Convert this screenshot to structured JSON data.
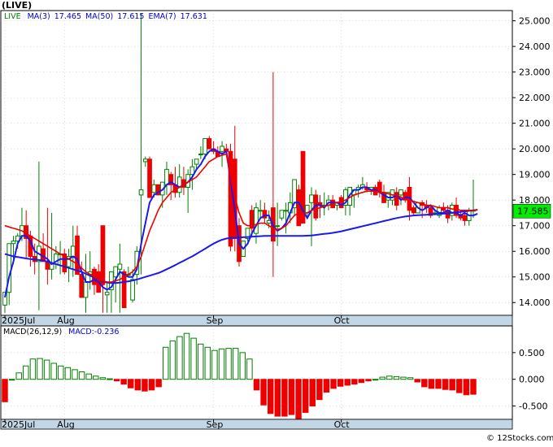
{
  "header": {
    "title": "(LIVE)",
    "legend": [
      {
        "label": "LIVE",
        "color": "#008000"
      },
      {
        "label": "MA(3)",
        "color": "#0000cc"
      },
      {
        "label": "17.465",
        "color": "#0000cc"
      },
      {
        "label": "MA(50)",
        "color": "#0000cc"
      },
      {
        "label": "17.615",
        "color": "#0000cc"
      },
      {
        "label": "EMA(7)",
        "color": "#0000cc"
      },
      {
        "label": "17.631",
        "color": "#0000cc"
      }
    ]
  },
  "macd_legend": [
    {
      "label": "MACD(26,12,9)",
      "color": "#000000"
    },
    {
      "label": "MACD:-0.236",
      "color": "#0000cc"
    }
  ],
  "watermark": "© 12Stocks.com",
  "colors": {
    "up": "#008000",
    "down": "#ee0000",
    "ma": "#1a1aee",
    "ema": "#ee0000",
    "last_tag": "#00ee00"
  },
  "chart_data": [
    {
      "type": "candlestick",
      "title": "(LIVE)",
      "ylim": [
        13.5,
        25.4
      ],
      "y_ticks": [
        "25.000",
        "24.000",
        "23.000",
        "22.000",
        "21.000",
        "20.000",
        "19.000",
        "18.000",
        "17.000",
        "16.000",
        "15.000",
        "14.000"
      ],
      "y_tick_values": [
        25,
        24,
        23,
        22,
        21,
        20,
        19,
        18,
        17,
        16,
        15,
        14
      ],
      "x_labels": [
        "2025Jul",
        "Aug",
        "Sep",
        "Oct"
      ],
      "x_label_index": [
        0,
        14,
        49,
        79
      ],
      "last_value": "17.585",
      "candles": [
        [
          13.9,
          14.4,
          13.6,
          14.4
        ],
        [
          14.4,
          16.3,
          13.9,
          16.3
        ],
        [
          16.3,
          16.6,
          15.5,
          16.4
        ],
        [
          16.4,
          16.7,
          16.1,
          16.6
        ],
        [
          16.6,
          17.7,
          16.4,
          17.0
        ],
        [
          17.0,
          17.6,
          15.7,
          16.5
        ],
        [
          16.6,
          16.8,
          15.4,
          15.8
        ],
        [
          15.8,
          16.3,
          15.1,
          15.6
        ],
        [
          15.6,
          19.5,
          13.7,
          16.2
        ],
        [
          16.1,
          16.7,
          15.6,
          15.6
        ],
        [
          15.6,
          17.7,
          14.7,
          15.3
        ],
        [
          15.3,
          17.5,
          14.9,
          15.5
        ],
        [
          15.5,
          16.2,
          15.3,
          15.9
        ],
        [
          15.9,
          16.4,
          15.1,
          15.9
        ],
        [
          15.9,
          16.1,
          15.1,
          15.2
        ],
        [
          15.4,
          16.1,
          14.8,
          15.8
        ],
        [
          15.8,
          17.0,
          15.0,
          16.2
        ],
        [
          16.6,
          17.0,
          15.1,
          15.1
        ],
        [
          15.1,
          15.6,
          14.2,
          14.2
        ],
        [
          14.2,
          15.9,
          13.6,
          14.8
        ],
        [
          15.1,
          16.0,
          14.5,
          15.2
        ],
        [
          15.3,
          15.4,
          14.3,
          14.7
        ],
        [
          15.2,
          15.5,
          14.4,
          14.4
        ],
        [
          17.0,
          17.0,
          13.6,
          14.7
        ],
        [
          14.3,
          14.8,
          13.6,
          14.4
        ],
        [
          14.5,
          15.2,
          13.6,
          15.2
        ],
        [
          15.0,
          15.4,
          14.0,
          15.4
        ],
        [
          15.3,
          16.3,
          13.6,
          15.5
        ],
        [
          15.2,
          15.3,
          13.8,
          13.8
        ],
        [
          15.1,
          15.4,
          15.0,
          15.1
        ],
        [
          14.1,
          15.3,
          14.0,
          14.9
        ],
        [
          15.1,
          16.2,
          14.7,
          16.0
        ],
        [
          18.2,
          25.3,
          15.1,
          18.4
        ],
        [
          19.5,
          19.7,
          19.3,
          19.6
        ],
        [
          19.6,
          19.7,
          18.1,
          18.1
        ],
        [
          18.3,
          18.8,
          18.1,
          18.6
        ],
        [
          18.6,
          18.6,
          18.2,
          18.2
        ],
        [
          18.2,
          18.7,
          17.7,
          18.7
        ],
        [
          18.6,
          19.5,
          18.2,
          19.2
        ],
        [
          19.0,
          19.1,
          18.0,
          18.6
        ],
        [
          18.6,
          19.3,
          18.1,
          18.3
        ],
        [
          18.3,
          19.4,
          18.1,
          18.9
        ],
        [
          18.8,
          19.3,
          18.2,
          18.5
        ],
        [
          18.5,
          19.2,
          17.5,
          19.0
        ],
        [
          19.0,
          19.6,
          18.4,
          19.3
        ],
        [
          19.4,
          19.6,
          19.2,
          19.6
        ],
        [
          19.8,
          20.1,
          19.6,
          19.8
        ],
        [
          19.8,
          20.4,
          19.6,
          20.4
        ],
        [
          20.4,
          20.5,
          20.0,
          20.0
        ],
        [
          20.0,
          20.3,
          19.8,
          19.9
        ],
        [
          19.9,
          20.1,
          19.7,
          19.7
        ],
        [
          19.9,
          20.3,
          19.3,
          20.1
        ],
        [
          20.0,
          20.2,
          19.9,
          19.9
        ],
        [
          19.9,
          20.2,
          16.0,
          16.2
        ],
        [
          19.6,
          20.9,
          16.0,
          16.5
        ],
        [
          17.0,
          17.3,
          15.4,
          15.6
        ],
        [
          15.8,
          16.4,
          15.8,
          16.4
        ],
        [
          16.5,
          16.9,
          16.4,
          16.9
        ],
        [
          17.6,
          17.8,
          16.6,
          16.9
        ],
        [
          16.7,
          17.9,
          16.3,
          17.7
        ],
        [
          17.6,
          18.0,
          17.3,
          17.6
        ],
        [
          17.6,
          17.9,
          17.1,
          17.3
        ],
        [
          17.1,
          17.6,
          16.9,
          17.2
        ],
        [
          17.7,
          23.0,
          15.0,
          16.4
        ],
        [
          17.0,
          17.9,
          16.2,
          17.0
        ],
        [
          17.3,
          17.6,
          17.2,
          17.6
        ],
        [
          17.6,
          17.9,
          16.7,
          17.6
        ],
        [
          17.5,
          18.3,
          17.1,
          17.9
        ],
        [
          17.7,
          18.8,
          17.4,
          18.8
        ],
        [
          18.4,
          18.6,
          17.0,
          17.0
        ],
        [
          19.9,
          19.9,
          17.1,
          17.1
        ],
        [
          17.5,
          17.8,
          17.3,
          17.8
        ],
        [
          17.9,
          18.5,
          16.2,
          18.2
        ],
        [
          18.2,
          18.4,
          17.2,
          17.3
        ],
        [
          17.9,
          18.2,
          17.3,
          17.8
        ],
        [
          17.8,
          18.3,
          17.4,
          17.8
        ],
        [
          17.8,
          18.2,
          17.6,
          18.0
        ],
        [
          18.0,
          18.2,
          17.7,
          17.7
        ],
        [
          17.8,
          17.9,
          17.6,
          17.9
        ],
        [
          18.1,
          18.2,
          17.7,
          17.7
        ],
        [
          17.8,
          18.5,
          17.4,
          18.4
        ],
        [
          17.8,
          18.5,
          17.4,
          18.5
        ],
        [
          18.2,
          18.4,
          17.7,
          18.4
        ],
        [
          18.4,
          18.6,
          18.1,
          18.5
        ],
        [
          18.5,
          18.9,
          18.4,
          18.6
        ],
        [
          18.5,
          18.7,
          18.3,
          18.4
        ],
        [
          18.4,
          18.5,
          18.2,
          18.5
        ],
        [
          18.5,
          18.6,
          18.2,
          18.2
        ],
        [
          18.7,
          18.8,
          18.1,
          18.3
        ],
        [
          18.3,
          18.6,
          17.9,
          17.9
        ],
        [
          18.0,
          18.3,
          17.7,
          18.3
        ],
        [
          18.0,
          18.4,
          17.8,
          18.4
        ],
        [
          18.3,
          18.5,
          17.6,
          17.8
        ],
        [
          18.2,
          18.4,
          17.8,
          18.4
        ],
        [
          18.3,
          18.4,
          17.9,
          18.0
        ],
        [
          18.5,
          18.9,
          17.2,
          17.6
        ],
        [
          17.7,
          17.8,
          17.4,
          17.5
        ],
        [
          17.5,
          17.9,
          17.5,
          17.9
        ],
        [
          17.9,
          18.0,
          17.3,
          17.8
        ],
        [
          17.8,
          18.0,
          17.5,
          17.7
        ],
        [
          17.7,
          17.8,
          17.3,
          17.4
        ],
        [
          17.5,
          17.6,
          17.4,
          17.5
        ],
        [
          17.4,
          17.8,
          17.3,
          17.7
        ],
        [
          17.7,
          17.9,
          17.5,
          17.6
        ],
        [
          17.6,
          17.8,
          17.1,
          17.3
        ],
        [
          17.4,
          17.9,
          17.2,
          17.8
        ],
        [
          17.8,
          18.1,
          17.3,
          17.4
        ],
        [
          17.4,
          17.6,
          17.2,
          17.3
        ],
        [
          17.4,
          17.5,
          17.0,
          17.2
        ],
        [
          17.2,
          17.7,
          17.0,
          17.6
        ],
        [
          17.6,
          18.8,
          17.3,
          17.6
        ]
      ],
      "series": [
        {
          "name": "MA(3)",
          "values": [
            14.2,
            15.0,
            15.6,
            16.3,
            16.6,
            16.6,
            16.4,
            16.0,
            15.9,
            15.8,
            15.7,
            15.5,
            15.6,
            15.7,
            15.7,
            15.7,
            15.8,
            15.7,
            15.2,
            14.8,
            14.8,
            14.9,
            14.8,
            14.6,
            14.5,
            14.6,
            14.9,
            15.2,
            15.1,
            15.0,
            15.0,
            15.3,
            16.3,
            17.1,
            17.9,
            18.2,
            18.3,
            18.4,
            18.6,
            18.7,
            18.6,
            18.5,
            18.6,
            18.7,
            18.9,
            19.2,
            19.4,
            19.7,
            19.9,
            20.0,
            19.9,
            19.8,
            19.9,
            18.8,
            17.6,
            16.3,
            16.1,
            16.3,
            16.7,
            17.0,
            17.3,
            17.4,
            17.4,
            17.0,
            16.8,
            16.9,
            17.1,
            17.5,
            17.9,
            17.9,
            17.6,
            17.3,
            17.6,
            17.8,
            17.8,
            17.7,
            17.9,
            17.9,
            17.9,
            17.8,
            17.9,
            18.2,
            18.4,
            18.4,
            18.5,
            18.5,
            18.4,
            18.4,
            18.3,
            18.2,
            18.1,
            18.1,
            18.2,
            18.0,
            18.1,
            18.1,
            17.9,
            17.7,
            17.6,
            17.7,
            17.8,
            17.6,
            17.5,
            17.5,
            17.6,
            17.5,
            17.5,
            17.4,
            17.5,
            17.4,
            17.4,
            17.465
          ]
        },
        {
          "name": "MA(50)",
          "values": [
            15.9,
            15.85,
            15.8,
            15.78,
            15.75,
            15.72,
            15.7,
            15.68,
            15.66,
            15.64,
            15.6,
            15.55,
            15.5,
            15.45,
            15.4,
            15.35,
            15.3,
            15.25,
            15.2,
            15.12,
            15.05,
            14.98,
            14.9,
            14.83,
            14.78,
            14.76,
            14.76,
            14.78,
            14.8,
            14.83,
            14.86,
            14.9,
            14.95,
            15.0,
            15.05,
            15.1,
            15.15,
            15.22,
            15.3,
            15.38,
            15.46,
            15.55,
            15.63,
            15.72,
            15.8,
            15.9,
            16.0,
            16.1,
            16.2,
            16.3,
            16.38,
            16.45,
            16.5,
            16.52,
            16.53,
            16.54,
            16.55,
            16.56,
            16.57,
            16.58,
            16.59,
            16.6,
            16.6,
            16.6,
            16.6,
            16.6,
            16.6,
            16.6,
            16.6,
            16.6,
            16.6,
            16.61,
            16.62,
            16.64,
            16.66,
            16.68,
            16.7,
            16.72,
            16.75,
            16.78,
            16.82,
            16.86,
            16.9,
            16.94,
            16.98,
            17.02,
            17.06,
            17.1,
            17.14,
            17.18,
            17.22,
            17.26,
            17.3,
            17.33,
            17.36,
            17.38,
            17.4,
            17.41,
            17.42,
            17.43,
            17.44,
            17.45,
            17.46,
            17.47,
            17.48,
            17.5,
            17.52,
            17.54,
            17.56,
            17.58,
            17.6,
            17.615
          ]
        },
        {
          "name": "EMA(7)",
          "values": [
            17.0,
            16.95,
            16.9,
            16.85,
            16.8,
            16.7,
            16.6,
            16.5,
            16.4,
            16.3,
            16.2,
            16.1,
            16.0,
            15.9,
            15.8,
            15.7,
            15.6,
            15.5,
            15.35,
            15.2,
            15.1,
            15.0,
            14.9,
            14.85,
            14.8,
            14.8,
            14.85,
            14.9,
            15.0,
            15.1,
            15.2,
            15.4,
            15.8,
            16.3,
            16.8,
            17.2,
            17.6,
            17.9,
            18.1,
            18.3,
            18.4,
            18.5,
            18.6,
            18.7,
            18.8,
            18.9,
            19.1,
            19.3,
            19.5,
            19.6,
            19.7,
            19.75,
            19.8,
            18.9,
            18.1,
            17.5,
            17.1,
            17.0,
            17.0,
            17.05,
            17.1,
            17.1,
            17.0,
            16.9,
            16.85,
            16.9,
            17.0,
            17.2,
            17.4,
            17.5,
            17.5,
            17.5,
            17.6,
            17.65,
            17.7,
            17.75,
            17.8,
            17.85,
            17.9,
            17.95,
            18.0,
            18.1,
            18.2,
            18.25,
            18.3,
            18.35,
            18.35,
            18.35,
            18.3,
            18.3,
            18.25,
            18.2,
            18.2,
            18.1,
            18.05,
            18.0,
            17.95,
            17.9,
            17.85,
            17.8,
            17.8,
            17.75,
            17.7,
            17.7,
            17.7,
            17.65,
            17.65,
            17.6,
            17.6,
            17.6,
            17.6,
            17.631
          ]
        }
      ]
    },
    {
      "type": "bar",
      "title": "MACD(26,12,9)",
      "ylim": [
        -0.75,
        1.0
      ],
      "y_ticks": [
        "0.500",
        "0.000",
        "-0.500"
      ],
      "y_tick_values": [
        0.5,
        0.0,
        -0.5
      ],
      "x_labels": [
        "2025Jul",
        "Aug",
        "Sep",
        "Oct"
      ],
      "x_label_index": [
        0,
        14,
        49,
        79
      ],
      "values": [
        -0.42,
        0.0,
        0.12,
        0.25,
        0.38,
        0.39,
        0.36,
        0.3,
        0.25,
        0.22,
        0.18,
        0.14,
        0.1,
        0.06,
        0.03,
        0.01,
        -0.03,
        -0.09,
        -0.16,
        -0.2,
        -0.22,
        -0.2,
        -0.14,
        0.6,
        0.72,
        0.8,
        0.86,
        0.77,
        0.66,
        0.6,
        0.54,
        0.57,
        0.58,
        0.58,
        0.5,
        0.38,
        -0.2,
        -0.48,
        -0.64,
        -0.69,
        -0.69,
        -0.66,
        -0.74,
        -0.62,
        -0.5,
        -0.38,
        -0.24,
        -0.17,
        -0.13,
        -0.11,
        -0.09,
        -0.06,
        -0.03,
        0.0,
        0.04,
        0.06,
        0.05,
        0.04,
        0.03,
        -0.05,
        -0.14,
        -0.17,
        -0.17,
        -0.19,
        -0.2,
        -0.25,
        -0.29,
        -0.28
      ]
    }
  ]
}
